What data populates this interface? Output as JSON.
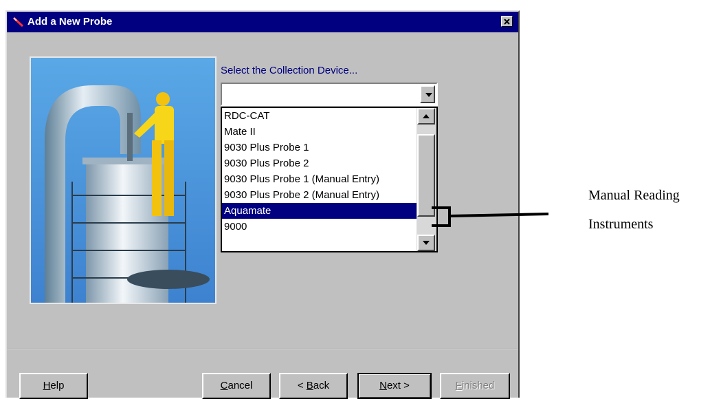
{
  "window": {
    "title": "Add a New Probe",
    "title_icon": "probe-icon",
    "close_icon": "close-icon"
  },
  "prompt": "Select the Collection Device...",
  "combo": {
    "value": ""
  },
  "device_list": [
    {
      "label": "RDC-CAT",
      "selected": false
    },
    {
      "label": "Mate II",
      "selected": false
    },
    {
      "label": "9030 Plus Probe 1",
      "selected": false
    },
    {
      "label": "9030 Plus Probe 2",
      "selected": false
    },
    {
      "label": "9030 Plus Probe 1 (Manual Entry)",
      "selected": false
    },
    {
      "label": "9030 Plus Probe 2 (Manual Entry)",
      "selected": false
    },
    {
      "label": "Aquamate",
      "selected": true
    },
    {
      "label": "9000",
      "selected": false
    }
  ],
  "buttons": {
    "help": {
      "prefix": "",
      "mnemonic": "H",
      "rest": "elp"
    },
    "cancel": {
      "prefix": "",
      "mnemonic": "C",
      "rest": "ancel"
    },
    "back": {
      "prefix": "< ",
      "mnemonic": "B",
      "rest": "ack"
    },
    "next": {
      "prefix": "",
      "mnemonic": "N",
      "rest": "ext >"
    },
    "finished": {
      "prefix": "",
      "mnemonic": "F",
      "rest": "inished"
    }
  },
  "annotation": {
    "line1": "Manual Reading",
    "line2": "Instruments"
  },
  "colors": {
    "titlebar": "#000080",
    "dialog_bg": "#c0c0c0",
    "selection": "#000080",
    "prompt_text": "#000080"
  }
}
